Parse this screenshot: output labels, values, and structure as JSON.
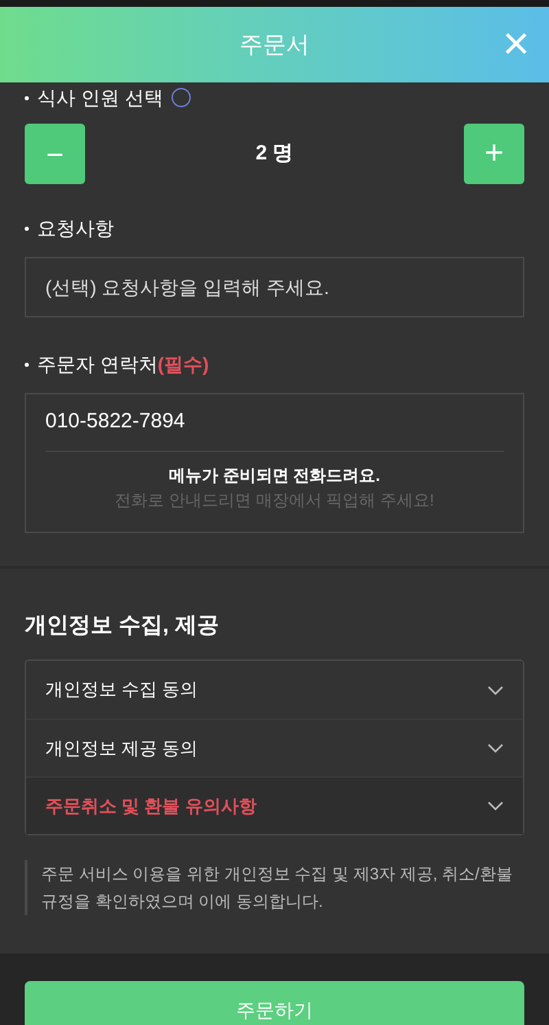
{
  "header": {
    "title": "주문서",
    "close": "×"
  },
  "party": {
    "label": "식사 인원 선택",
    "minus": "−",
    "value": "2 명",
    "plus": "+"
  },
  "request": {
    "label": "요청사항",
    "placeholder": "(선택) 요청사항을 입력해 주세요."
  },
  "contact": {
    "label": "주문자 연락처",
    "required_mark": "(필수)",
    "phone": "010-5822-7894",
    "message": "메뉴가 준비되면 전화드려요.",
    "note": "전화로 안내드리면 매장에서 픽업해 주세요!"
  },
  "privacy": {
    "heading": "개인정보 수집, 제공",
    "items": [
      {
        "label": "개인정보 수집 동의",
        "warning": false,
        "expanded": false
      },
      {
        "label": "개인정보 제공 동의",
        "warning": false,
        "expanded": false
      },
      {
        "label": "주문취소 및 환불 유의사항",
        "warning": true,
        "expanded": false
      }
    ],
    "notice": "주문 서비스 이용을 위한 개인정보 수집 및 제3자 제공, 취소/환불 규정을 확인하였으며 이에 동의합니다."
  },
  "submit": "주문하기"
}
